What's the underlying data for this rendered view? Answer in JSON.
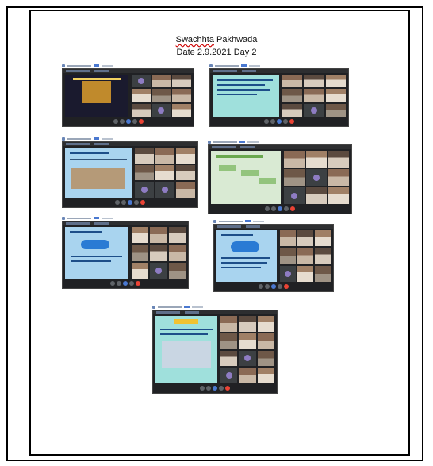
{
  "document": {
    "title_word1": "Swachhta",
    "title_word2": "Pakhwada",
    "subtitle": "Date 2.9.2021   Day 2"
  },
  "screenshots": [
    {
      "id": "1",
      "slide": "dark"
    },
    {
      "id": "2",
      "slide": "teal"
    },
    {
      "id": "3",
      "slide": "blue"
    },
    {
      "id": "4",
      "slide": "green"
    },
    {
      "id": "5",
      "slide": "blue"
    },
    {
      "id": "6",
      "slide": "blue"
    },
    {
      "id": "7",
      "slide": "teal"
    }
  ],
  "colors": {
    "end_call": "#ea4335",
    "meet_bg": "#202124",
    "accent": "#4a78d0"
  }
}
